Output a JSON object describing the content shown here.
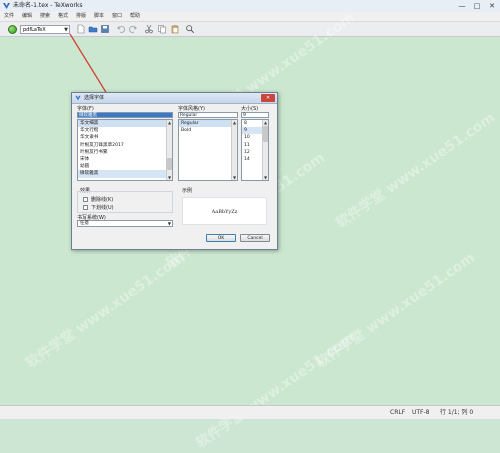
{
  "window": {
    "title": "未命名-1.tex - TeXworks",
    "minimize": "—",
    "maximize": "□",
    "close": "✕"
  },
  "menu": [
    "文件",
    "编辑",
    "搜索",
    "格式",
    "排版",
    "脚本",
    "窗口",
    "帮助"
  ],
  "toolbar": {
    "engine": "pdfLaTeX",
    "icons": [
      "new-file-icon",
      "open-folder-icon",
      "save-icon",
      "undo-icon",
      "redo-icon",
      "cut-icon",
      "copy-icon",
      "paste-icon",
      "search-icon"
    ]
  },
  "watermark": "软件学堂  www.xue51.com",
  "dialog": {
    "title": "选择字体",
    "font_label": "字体(F)",
    "font_input": "微软雅黑",
    "fonts": [
      "华文细黑",
      "华文行楷",
      "华文隶书",
      "叶根友刀锋黑草2017",
      "叶根友行书繁",
      "宋体",
      "幼圆",
      "微软雅黑"
    ],
    "style_label": "字体风格(Y)",
    "style_input": "Regular",
    "styles": [
      "Regular",
      "Bold"
    ],
    "size_label": "大小(S)",
    "size_input": "9",
    "sizes": [
      "8",
      "9",
      "10",
      "11",
      "12",
      "14"
    ],
    "effects_label": "效果",
    "strikeout_label": "删除线(K)",
    "underline_label": "下划线(U)",
    "writing_system_label": "书写系统(W)",
    "writing_system_value": "任意",
    "sample_label": "示例",
    "sample_text": "AaBbYyZz",
    "ok_label": "OK",
    "cancel_label": "Cancel"
  },
  "status": {
    "line_ending": "CRLF",
    "encoding": "UTF-8",
    "position": "行 1/1; 列 0"
  },
  "colors": {
    "editor_bg": "#cbe7cf",
    "arrow": "#d23a2f",
    "selection": "#d5e5f6"
  }
}
